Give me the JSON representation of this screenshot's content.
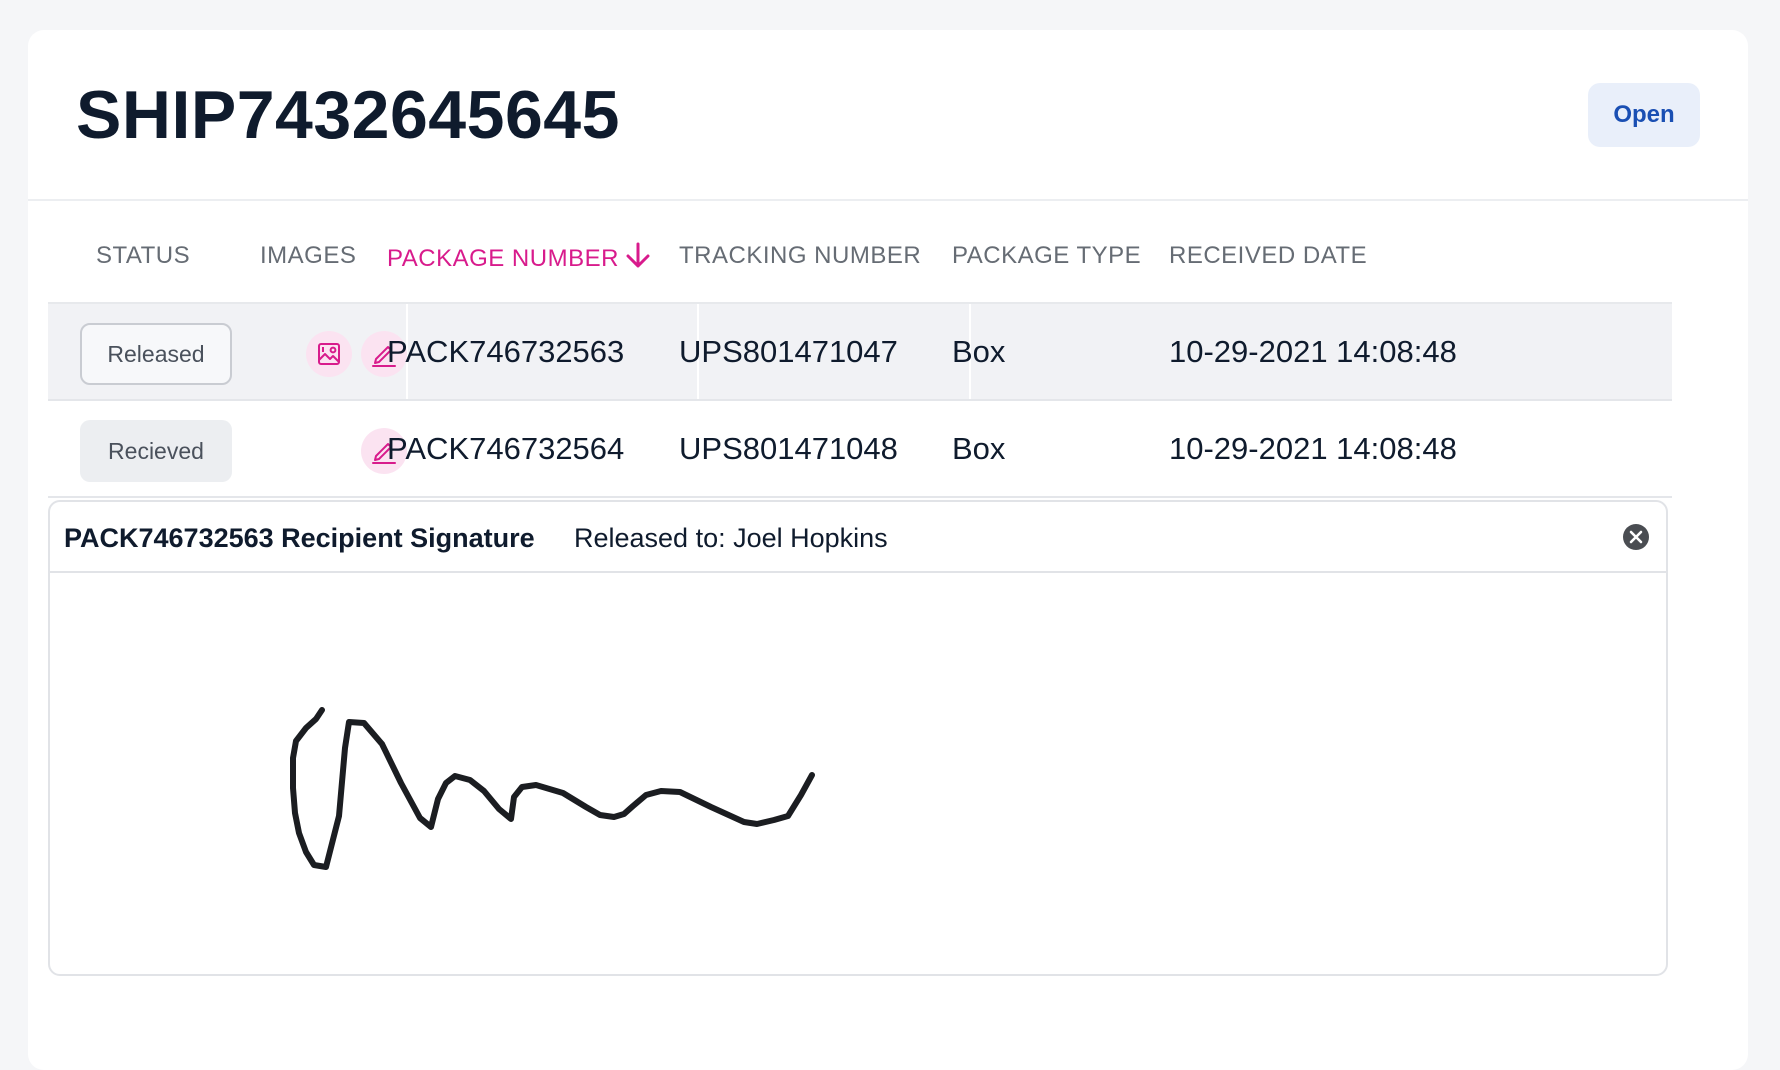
{
  "shipment": {
    "id": "SHIP7432645645",
    "status_button": "Open"
  },
  "table": {
    "columns": {
      "status": "STATUS",
      "images": "IMAGES",
      "package_number": "PACKAGE NUMBER",
      "tracking_number": "TRACKING NUMBER",
      "package_type": "PACKAGE TYPE",
      "received_date": "RECEIVED DATE"
    },
    "sort": {
      "column": "package_number",
      "direction": "descending"
    },
    "rows": [
      {
        "status": "Released",
        "package_number": "PACK746732563",
        "tracking_number": "UPS801471047",
        "package_type": "Box",
        "received_date": "10-29-2021 14:08:48"
      },
      {
        "status": "Recieved",
        "package_number": "PACK746732564",
        "tracking_number": "UPS801471048",
        "package_type": "Box",
        "received_date": "10-29-2021 14:08:48"
      }
    ]
  },
  "signature_panel": {
    "title": "PACK746732563 Recipient Signature",
    "released_to": "Released to: Joel Hopkins"
  },
  "colors": {
    "accent": "#d81b8c",
    "accent_bg": "#fbe3f1",
    "open_button_bg": "#e9effa",
    "open_button_text": "#1a4fb3"
  },
  "icons": {
    "sort": "arrow-down-icon",
    "image": "image-gallery-icon",
    "edit": "pencil-icon",
    "close": "close-circle-icon"
  }
}
